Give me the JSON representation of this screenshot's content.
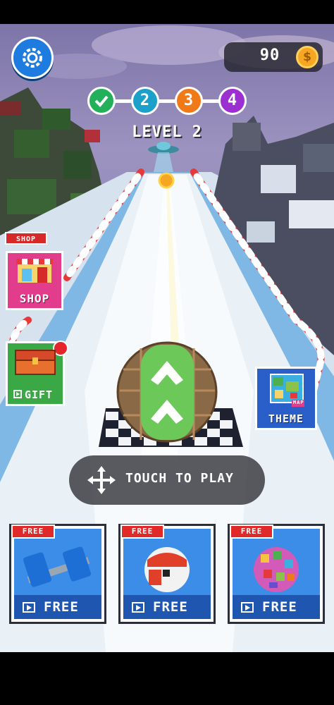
{
  "hud": {
    "coins": "90",
    "coin_symbol": "$",
    "level_title": "LEVEL 2",
    "levels": [
      {
        "label": "",
        "state": "done",
        "color": "#23b05a"
      },
      {
        "label": "2",
        "state": "current",
        "color": "#1aa0c9"
      },
      {
        "label": "3",
        "state": "upcoming",
        "color": "#f07a18"
      },
      {
        "label": "4",
        "state": "upcoming",
        "color": "#9b2fcf"
      }
    ]
  },
  "side_buttons": {
    "shop_sign": "SHOP",
    "shop_label": "SHOP",
    "gift_label": "GIFT",
    "theme_badge": "MAP",
    "theme_label": "THEME"
  },
  "prompt": {
    "touch_text": "TOUCH TO PLAY"
  },
  "rewards": [
    {
      "tag": "FREE",
      "label": "FREE",
      "item": "dumbbell-skin"
    },
    {
      "tag": "FREE",
      "label": "FREE",
      "item": "face-ball-skin"
    },
    {
      "tag": "FREE",
      "label": "FREE",
      "item": "rainbow-ball-skin"
    }
  ],
  "colors": {
    "accent_blue": "#1e7be0",
    "shop_pink": "#e23c8d",
    "gift_green": "#3aa845",
    "theme_blue": "#2a5fc9",
    "free_red": "#e02a2a"
  }
}
